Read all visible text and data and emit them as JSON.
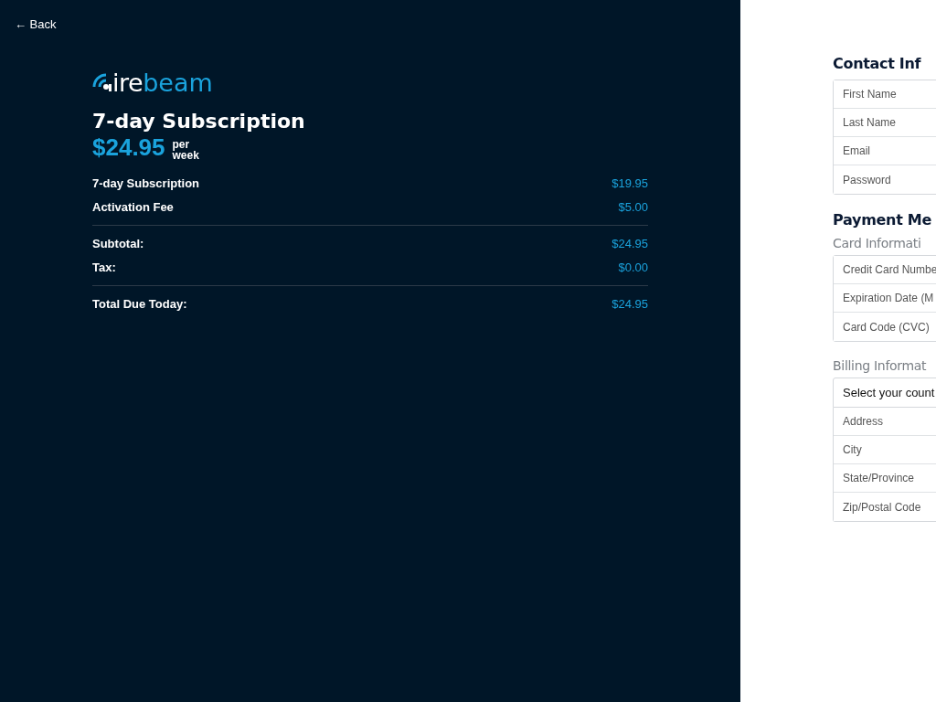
{
  "back_link": {
    "arrow": "←",
    "label": "Back"
  },
  "logo": {
    "part_1": "ire",
    "part_2": "beam"
  },
  "plan": {
    "title": "7-day Subscription",
    "price": "$24.95",
    "period_1": "per",
    "period_2": "week"
  },
  "summary_groups": [
    [
      {
        "label": "7-day Subscription",
        "amount": "$19.95"
      },
      {
        "label": "Activation Fee",
        "amount": "$5.00"
      }
    ],
    [
      {
        "label": "Subtotal:",
        "amount": "$24.95"
      },
      {
        "label": "Tax:",
        "amount": "$0.00"
      }
    ],
    [
      {
        "label": "Total Due Today:",
        "amount": "$24.95"
      }
    ]
  ],
  "contact": {
    "heading": "Contact Inf",
    "fields": [
      {
        "placeholder": "First Name"
      },
      {
        "placeholder": "Last Name"
      },
      {
        "placeholder": "Email"
      },
      {
        "placeholder": "Password"
      }
    ]
  },
  "payment": {
    "heading": "Payment Me",
    "card_heading": "Card Informati",
    "card_fields": [
      {
        "placeholder": "Credit Card Numbe"
      },
      {
        "placeholder": "Expiration Date (M"
      },
      {
        "placeholder": "Card Code (CVC)"
      }
    ],
    "billing_heading": "Billing Informat",
    "country_select": "Select your count",
    "billing_fields": [
      {
        "placeholder": "Address"
      },
      {
        "placeholder": "City"
      },
      {
        "placeholder": "State/Province"
      },
      {
        "placeholder": "Zip/Postal Code"
      }
    ]
  }
}
